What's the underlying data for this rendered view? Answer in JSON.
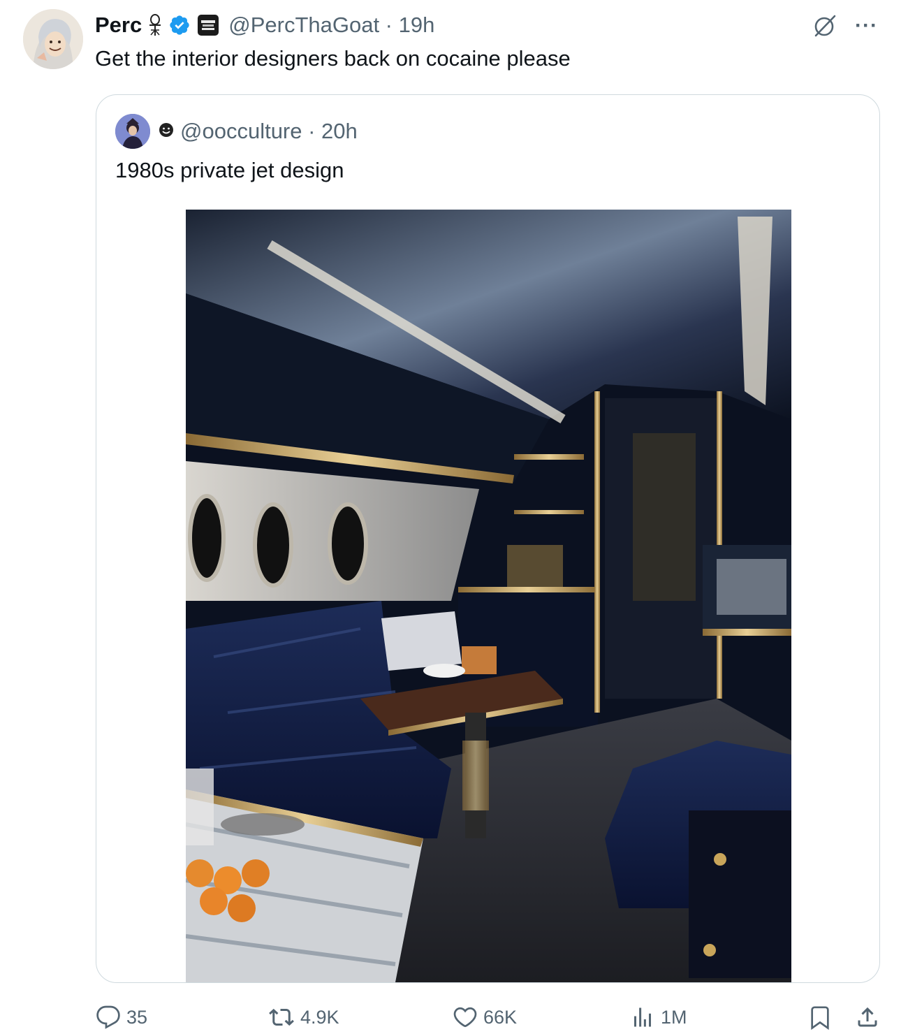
{
  "tweet": {
    "display_name": "Perc",
    "handle_time": "@PercThaGoat · 19h",
    "text": "Get the interior designers back on cocaine please"
  },
  "quoted_tweet": {
    "handle_time": "@oocculture · 20h",
    "text": "1980s private jet design",
    "media_alt": "1980s private jet cabin interior"
  },
  "actions": {
    "replies": "35",
    "reposts": "4.9K",
    "likes": "66K",
    "views": "1M"
  },
  "icons": {
    "emoji": "ankh-emoji-icon",
    "verified": "verified-badge-icon",
    "affiliate": "affiliate-badge-icon",
    "grok": "grok-icon",
    "more": "more-icon",
    "reply": "reply-icon",
    "repost": "repost-icon",
    "like": "like-icon",
    "views": "views-icon",
    "bookmark": "bookmark-icon",
    "share": "share-icon"
  },
  "colors": {
    "text_primary": "#0f1419",
    "text_secondary": "#536471",
    "verified_blue": "#1d9bf0",
    "border": "#cfd9de"
  }
}
